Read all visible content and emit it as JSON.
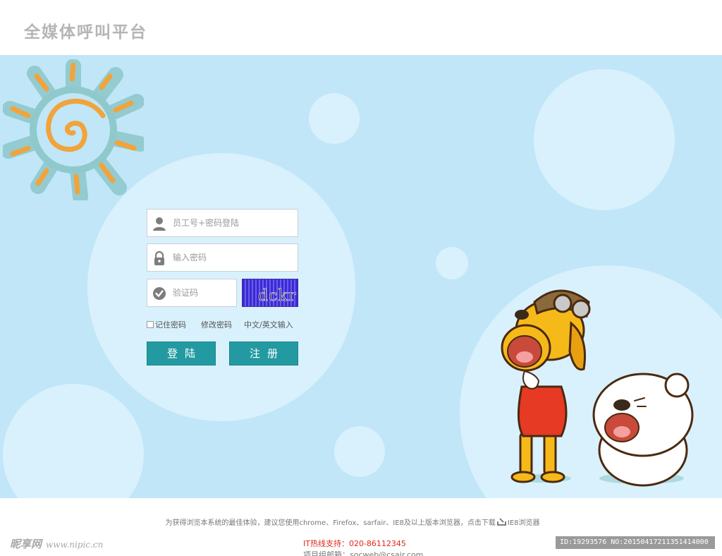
{
  "header": {
    "title": "全媒体呼叫平台"
  },
  "login_form": {
    "username_placeholder": "员工号+密码登陆",
    "password_placeholder": "输入密码",
    "captcha_placeholder": "验证码",
    "captcha_text": "dckr",
    "remember_label": "记住密码",
    "change_password_label": "修改密码",
    "language_toggle_label": "中文/英文输入",
    "login_button": "登陆",
    "register_button": "注册"
  },
  "footer": {
    "notice_prefix": "为获得浏览本系统的最佳体验，建议您使用chrome、Firefox、sarfair、IE8及以上版本浏览器，点击下载",
    "notice_link": "IE8浏览器",
    "hotline": "IT热线支持：020-86112345",
    "mailbox": "项目组邮箱：socweb@csair.com"
  },
  "watermark": {
    "left_brand": "昵享网",
    "left_url": "www.nipic.cn",
    "right_id": "ID:19293576 NO:20150417211351414000"
  },
  "colors": {
    "background": "#c0e6f8",
    "bubble": "#d9f1fd",
    "button": "#239aa1",
    "hotline": "#e0271b",
    "title": "#b5b5b5"
  },
  "icons": [
    "user-icon",
    "lock-icon",
    "check-icon",
    "download-icon",
    "sun-illustration",
    "mascot-illustration"
  ]
}
